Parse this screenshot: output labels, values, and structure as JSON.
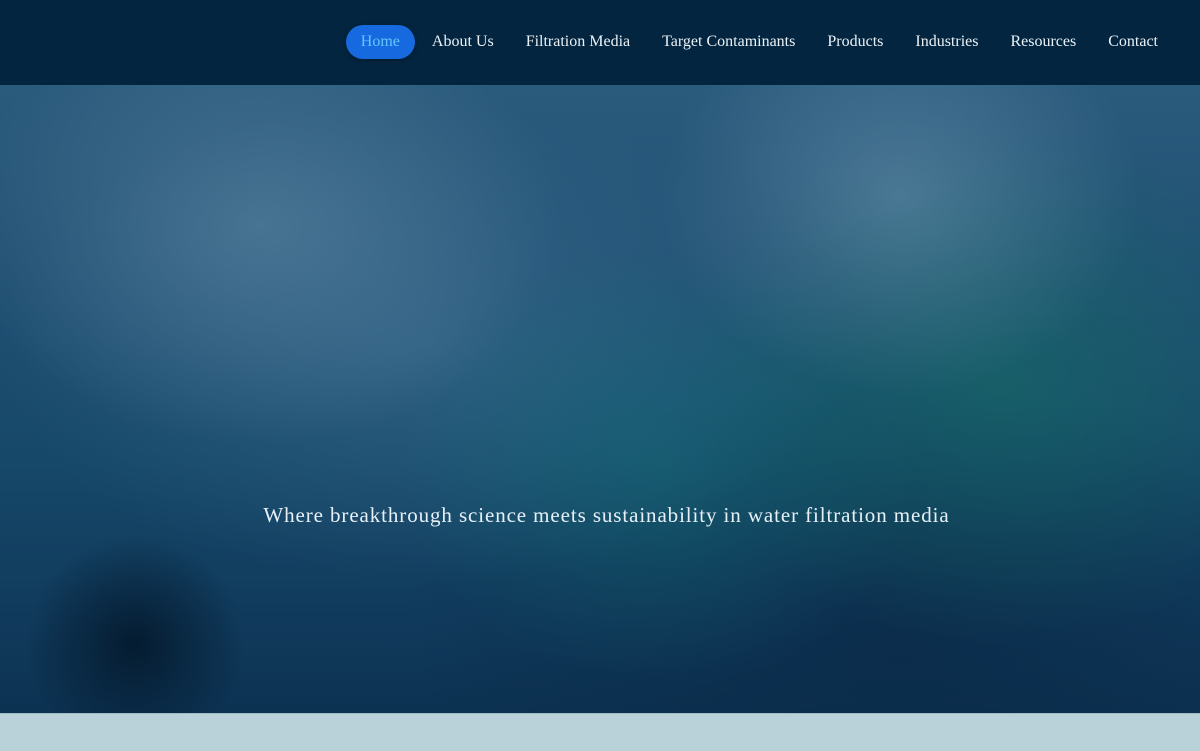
{
  "nav": {
    "items": [
      {
        "label": "Home",
        "active": true
      },
      {
        "label": "About Us"
      },
      {
        "label": "Filtration Media"
      },
      {
        "label": "Target Contaminants"
      },
      {
        "label": "Products"
      },
      {
        "label": "Industries"
      },
      {
        "label": "Resources"
      },
      {
        "label": "Contact"
      }
    ]
  },
  "hero": {
    "tagline": "Where breakthrough science meets sustainability in water filtration media"
  },
  "colors": {
    "header_bg": "#03253f",
    "nav_active_bg": "#1769e0",
    "nav_active_text": "#63c6ff",
    "hero_text": "#e6f0f6",
    "bottom_strip": "#b9d1d8"
  }
}
